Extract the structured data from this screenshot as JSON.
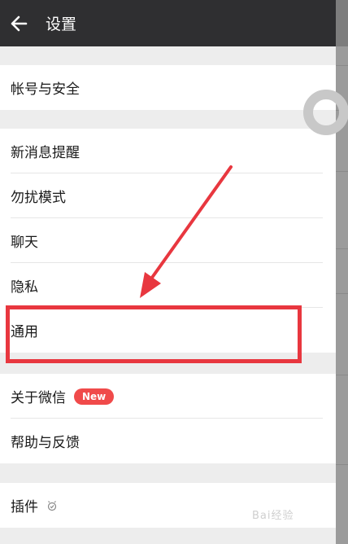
{
  "header": {
    "title": "设置",
    "back_icon": "arrow-left-icon"
  },
  "groups": {
    "account": {
      "items": [
        {
          "label": "帐号与安全"
        }
      ]
    },
    "main": {
      "items": [
        {
          "label": "新消息提醒"
        },
        {
          "label": "勿扰模式"
        },
        {
          "label": "聊天"
        },
        {
          "label": "隐私"
        },
        {
          "label": "通用"
        }
      ]
    },
    "about": {
      "items": [
        {
          "label": "关于微信",
          "badge": "New"
        },
        {
          "label": "帮助与反馈"
        }
      ]
    },
    "plugins": {
      "items": [
        {
          "label": "插件",
          "icon": "plugin-icon"
        }
      ]
    }
  },
  "colors": {
    "header_bg": "#2f2f31",
    "highlight": "#e8373f",
    "badge": "#f04a4a",
    "page_bg": "#ededed"
  }
}
